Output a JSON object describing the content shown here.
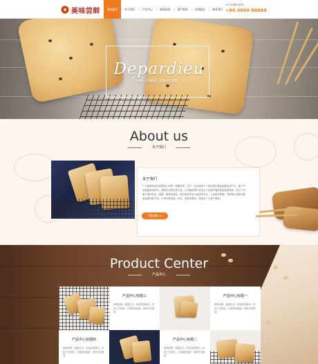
{
  "header": {
    "logo_text": "美味尝鲜",
    "nav": [
      {
        "label": "网站首页",
        "active": true
      },
      {
        "label": "关于我们",
        "active": false
      },
      {
        "label": "产品中心",
        "active": false
      },
      {
        "label": "新闻动态",
        "active": false
      },
      {
        "label": "客户案例",
        "active": false
      },
      {
        "label": "在线留言",
        "active": false
      },
      {
        "label": "联系我们",
        "active": false
      }
    ],
    "hotline_label": "24小时服务热线：",
    "hotline_number": "+86 0000 88888"
  },
  "banner": {
    "script_text": "Depardieu",
    "subtitle": "舌尖上的甜蜜 · 美味尽在掌握"
  },
  "about": {
    "title": "About us",
    "subtitle": "关于我们",
    "heading": "关于我们",
    "text": "广州某某食品科技有限公司是一家集研发、生产、技术服务于一体的现代食品高新技术产业，旗下产品涵盖烘焙系列、调味系列等多类产品。公司拥有现代化的生产线和严格的质量管理体系，致力于为客户提供安全、健康、美味的食品。我们始终坚持以品质求生存，以创新求发展，不断推出深受消费者喜爱的新产品，公司本着诚信、务实、创新的理念，竭诚为广大客户服务。",
    "more_label": "了解详情 >>"
  },
  "product": {
    "title": "Product Center",
    "subtitle": "产品中心",
    "items": [
      {
        "title": "产品中心标题三",
        "desc": "美味尝鲜，健康生活。精选优质原料，传统工艺烘焙，口感松软香甜，营养丰富美味。"
      },
      {
        "title": "产品中心标题一",
        "desc": "美味尝鲜，健康生活。精选优质原料，传统工艺烘焙，口感松软香甜，营养丰富美味。"
      },
      {
        "title": "产品中心标题四",
        "desc": "美味尝鲜，健康生活。精选优质原料，传统工艺烘焙，口感松软香甜，营养丰富美味。"
      },
      {
        "title": "产品中心标题二",
        "desc": "美味尝鲜，健康生活。精选优质原料，传统工艺烘焙，口感松软香甜，营养丰富美味。"
      }
    ]
  },
  "colors": {
    "accent": "#f07a1e",
    "brand_red": "#b3372b"
  }
}
